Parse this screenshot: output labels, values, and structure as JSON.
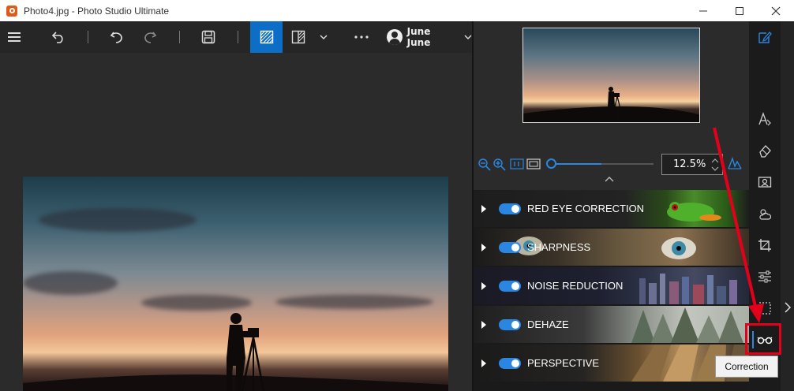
{
  "window": {
    "title": "Photo4.jpg - Photo Studio Ultimate",
    "controls": [
      "minimize",
      "maximize",
      "close"
    ]
  },
  "toolbar": {
    "items": [
      {
        "name": "menu",
        "icon": "hamburger-icon"
      },
      {
        "name": "back",
        "icon": "back-arrow-icon"
      },
      {
        "name": "undo",
        "icon": "undo-icon"
      },
      {
        "name": "redo",
        "icon": "redo-icon"
      },
      {
        "name": "save",
        "icon": "save-icon"
      },
      {
        "name": "single-view",
        "icon": "single-view-icon",
        "active": true
      },
      {
        "name": "compare-view",
        "icon": "split-view-icon"
      },
      {
        "name": "view-dropdown",
        "icon": "chevron-down-icon"
      },
      {
        "name": "more",
        "icon": "more-icon"
      }
    ],
    "user_name": "June June"
  },
  "preview": {
    "zoom_value": "12.5%"
  },
  "corrections": [
    {
      "label": "RED EYE CORRECTION",
      "enabled": true
    },
    {
      "label": "SHARPNESS",
      "enabled": true
    },
    {
      "label": "NOISE REDUCTION",
      "enabled": true
    },
    {
      "label": "DEHAZE",
      "enabled": true
    },
    {
      "label": "PERSPECTIVE",
      "enabled": true
    }
  ],
  "rail": {
    "icons": [
      "edit-icon",
      "text-icon",
      "eraser-icon",
      "portrait-icon",
      "weather-icon",
      "crop-icon",
      "adjust-icon",
      "selection-icon",
      "glasses-icon"
    ],
    "tooltip": "Correction"
  },
  "colors": {
    "accent": "#0d6ec8",
    "highlight": "#e3001b"
  }
}
